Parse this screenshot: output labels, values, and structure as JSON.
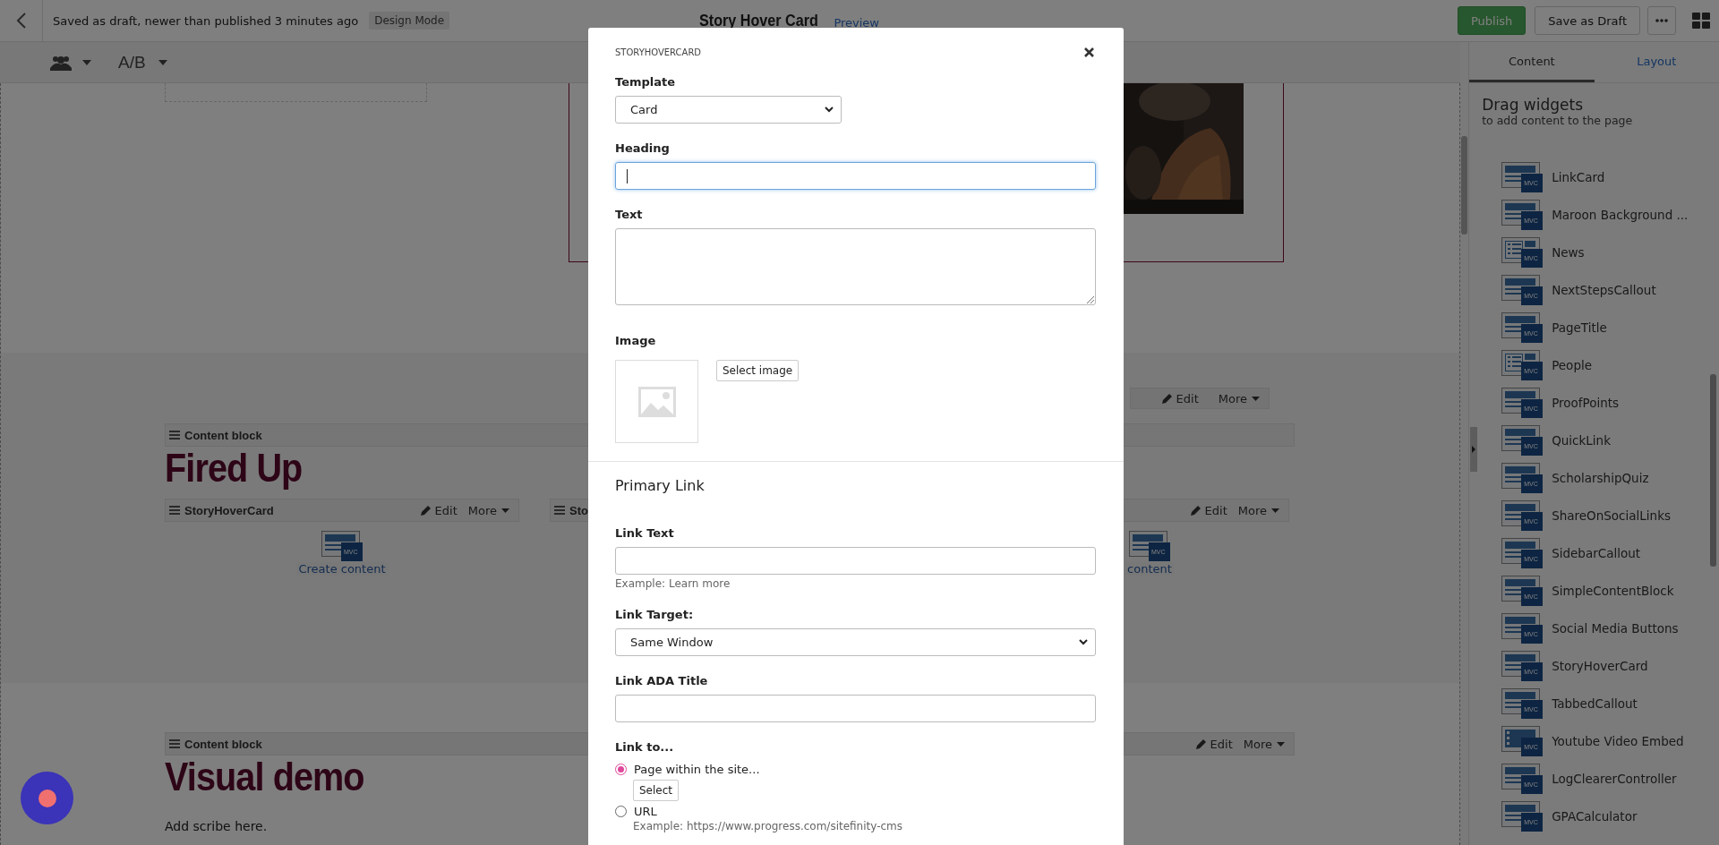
{
  "top_bar": {
    "status": "Saved as draft, newer than published 3 minutes ago",
    "mode_badge": "Design Mode",
    "page_title": "Story Hover Card",
    "preview_link": "Preview",
    "publish_button": "Publish",
    "draft_button": "Save as Draft"
  },
  "toolbar": {
    "ab_label": "A/B"
  },
  "canvas": {
    "upper_bar": {
      "edit": "Edit",
      "more": "More"
    },
    "fired_block": {
      "bar_label": "Content block",
      "heading": "Fired Up"
    },
    "widget_bars": [
      {
        "label": "StoryHoverCard",
        "edit": "Edit",
        "more": "More",
        "badge": "MVC",
        "create": "Create content"
      },
      {
        "label": "Sto"
      },
      {
        "edit": "Edit",
        "more": "More",
        "badge": "MVC",
        "create": "content"
      }
    ],
    "visual_block": {
      "bar_label": "Content block",
      "edit": "Edit",
      "more": "More",
      "heading": "Visual demo",
      "body": "Add scribe here."
    }
  },
  "side_panel": {
    "tabs": [
      {
        "label": "Content",
        "selected": true
      },
      {
        "label": "Layout",
        "selected": false
      }
    ],
    "title": "Drag widgets",
    "subtitle": "to add content to the page",
    "widgets": [
      {
        "name": "LinkCard",
        "kind": "card",
        "badge": "MVC"
      },
      {
        "name": "Maroon Background ...",
        "kind": "card",
        "badge": "MVC"
      },
      {
        "name": "News",
        "kind": "list",
        "badge": "MVC"
      },
      {
        "name": "NextStepsCallout",
        "kind": "card",
        "badge": "MVC"
      },
      {
        "name": "PageTitle",
        "kind": "card",
        "badge": "MVC"
      },
      {
        "name": "People",
        "kind": "list",
        "badge": "MVC"
      },
      {
        "name": "ProofPoints",
        "kind": "card",
        "badge": "MVC"
      },
      {
        "name": "QuickLink",
        "kind": "card",
        "badge": "MVC"
      },
      {
        "name": "ScholarshipQuiz",
        "kind": "card",
        "badge": "MVC"
      },
      {
        "name": "ShareOnSocialLinks",
        "kind": "card",
        "badge": "MVC"
      },
      {
        "name": "SidebarCallout",
        "kind": "card",
        "badge": "MVC"
      },
      {
        "name": "SimpleContentBlock",
        "kind": "card",
        "badge": "MVC"
      },
      {
        "name": "Social Media Buttons",
        "kind": "card",
        "badge": "MVC"
      },
      {
        "name": "StoryHoverCard",
        "kind": "card",
        "badge": "MVC"
      },
      {
        "name": "TabbedCallout",
        "kind": "card",
        "badge": "MVC"
      },
      {
        "name": "Youtube Video Embed",
        "kind": "video",
        "badge": "MVC"
      },
      {
        "name": "LogClearerController",
        "kind": "card",
        "badge": "MVC"
      },
      {
        "name": "GPACalculator",
        "kind": "card",
        "badge": "MVC"
      }
    ]
  },
  "dialog": {
    "title": "STORYHOVERCARD",
    "template": {
      "label": "Template",
      "value": "Card"
    },
    "heading": {
      "label": "Heading",
      "focused": true
    },
    "text": {
      "label": "Text"
    },
    "image": {
      "label": "Image",
      "button": "Select image"
    },
    "primary_link": {
      "title": "Primary Link",
      "link_text": {
        "label": "Link Text",
        "hint": "Example: Learn more"
      },
      "link_target": {
        "label": "Link Target:",
        "value": "Same Window"
      },
      "ada_title": {
        "label": "Link ADA Title"
      },
      "link_to": {
        "label": "Link to...",
        "options": [
          {
            "label": "Page within the site...",
            "selected": true,
            "button": "Select"
          },
          {
            "label": "URL",
            "selected": false,
            "hint": "Example: https://www.progress.com/sitefinity-cms"
          }
        ]
      }
    }
  }
}
